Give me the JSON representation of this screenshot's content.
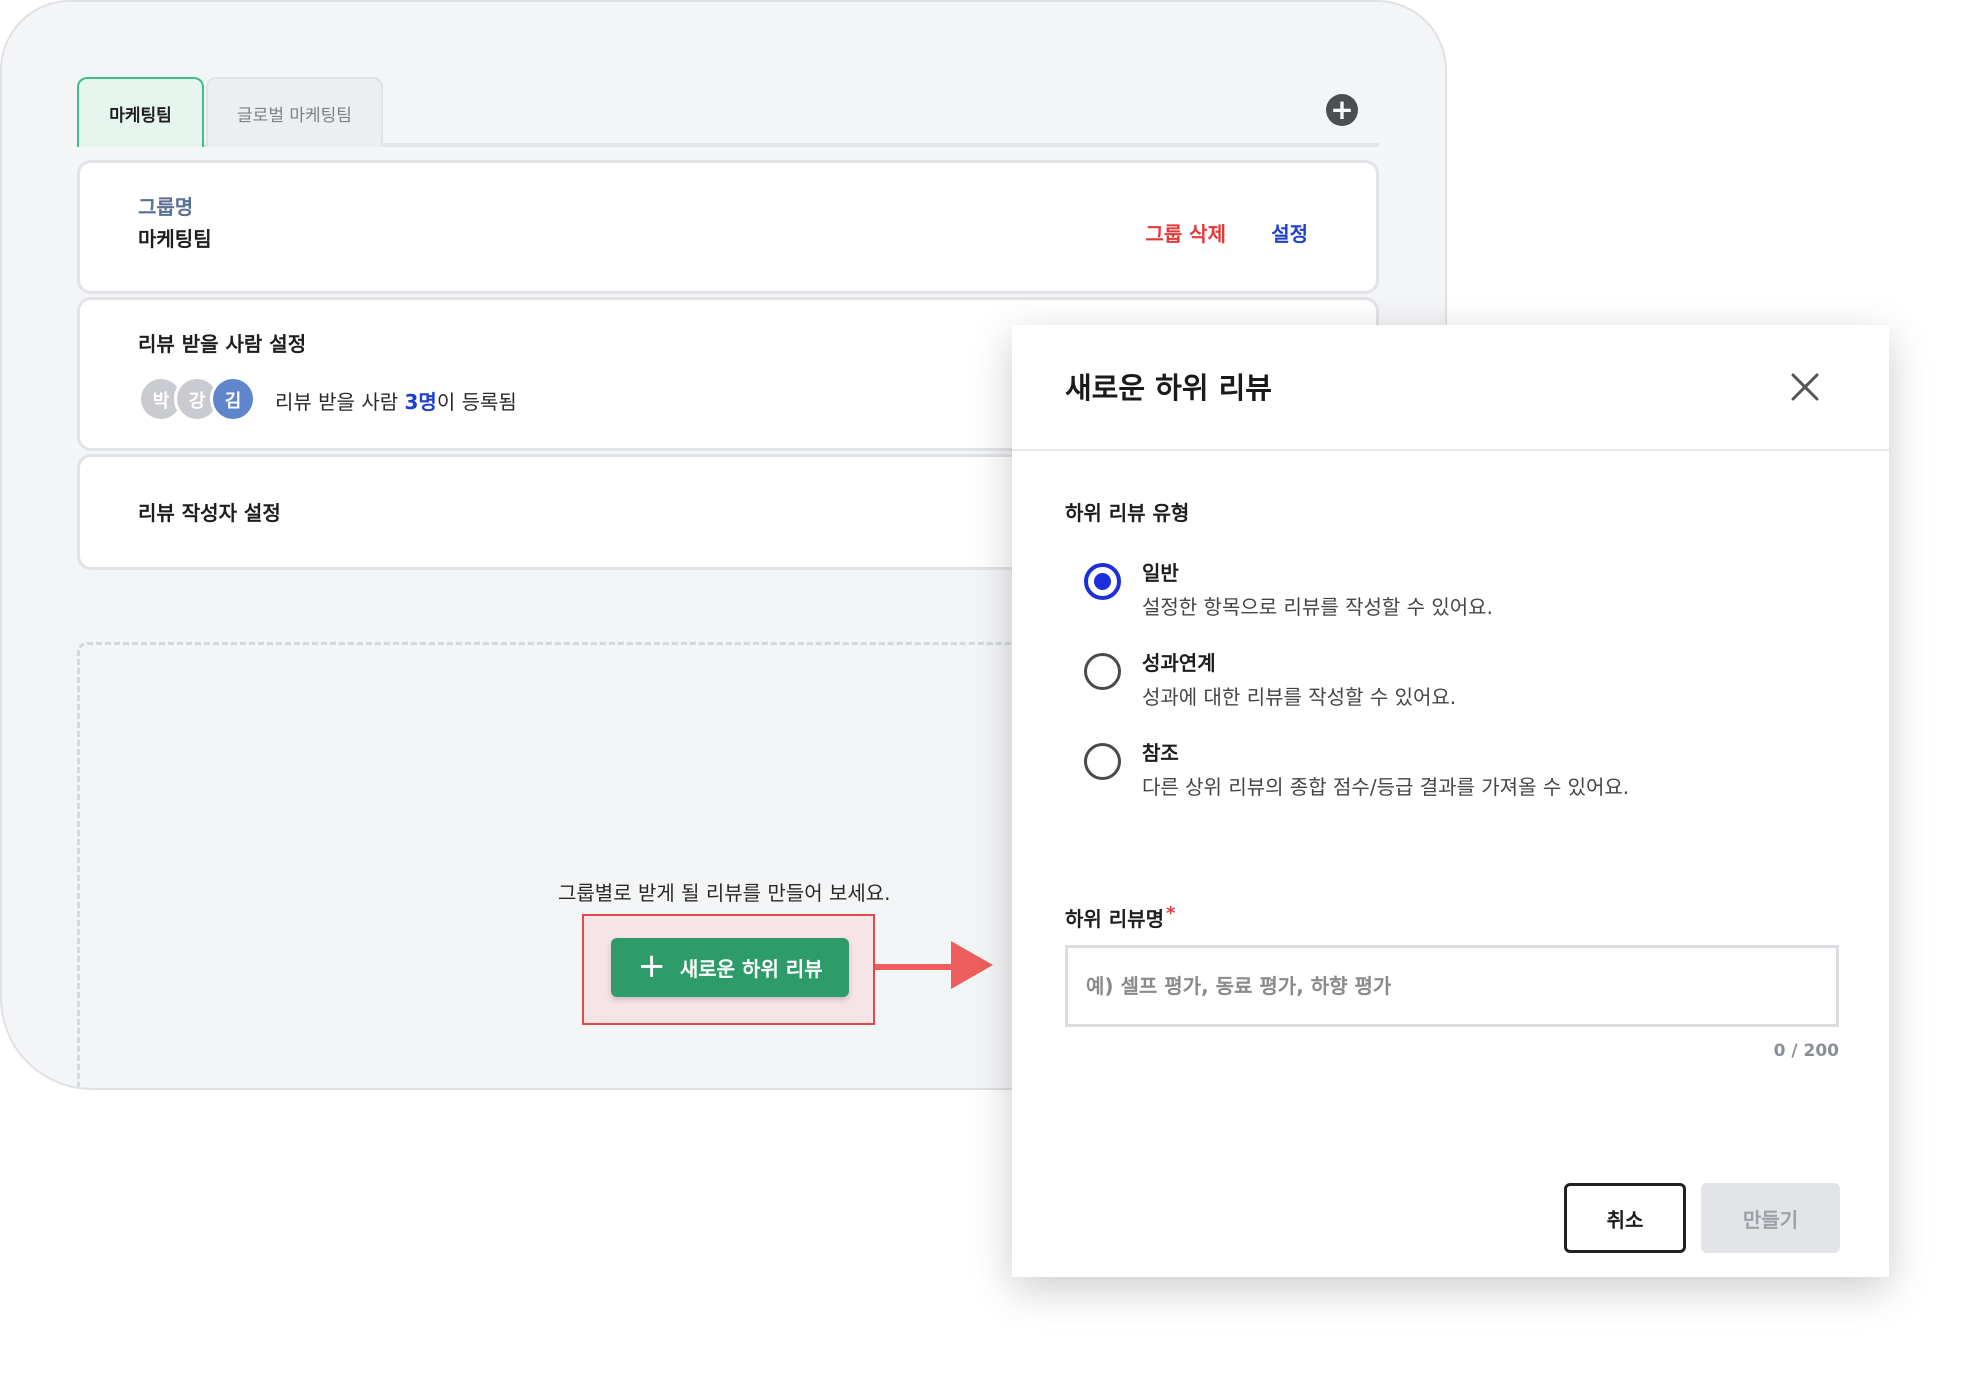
{
  "tabs": {
    "active_label": "마케팅팀",
    "inactive_label": "글로벌 마케팅팀"
  },
  "group_card": {
    "label": "그룹명",
    "name": "마케팅팀",
    "delete_label": "그룹 삭제",
    "settings_label": "설정"
  },
  "reviewee_card": {
    "title": "리뷰 받을 사람 설정",
    "avatars": [
      "박",
      "강",
      "김"
    ],
    "text_prefix": "리뷰 받을 사람 ",
    "count": "3명",
    "text_suffix": "이 등록됨"
  },
  "reviewer_card": {
    "title": "리뷰 작성자 설정"
  },
  "empty_state": {
    "message": "그룹별로 받게 될 리뷰를 만들어 보세요.",
    "button_label": "새로운 하위 리뷰"
  },
  "modal": {
    "title": "새로운 하위 리뷰",
    "type_label": "하위 리뷰 유형",
    "options": [
      {
        "title": "일반",
        "desc": "설정한 항목으로 리뷰를 작성할 수 있어요.",
        "selected": true
      },
      {
        "title": "성과연계",
        "desc": "성과에 대한 리뷰를 작성할 수 있어요.",
        "selected": false
      },
      {
        "title": "참조",
        "desc": "다른 상위 리뷰의 종합 점수/등급 결과를 가져올 수 있어요.",
        "selected": false
      }
    ],
    "name_label": "하위 리뷰명",
    "required_mark": "*",
    "name_value": "",
    "name_placeholder": "예) 셀프 평가, 동료 평가, 하향 평가",
    "char_count": "0 / 200",
    "cancel_label": "취소",
    "create_label": "만들기"
  },
  "colors": {
    "accent_green": "#2e9c6a",
    "radio_blue": "#1d2fdd",
    "danger_red": "#e23a3a",
    "link_blue": "#1d3fcf",
    "arrow_red": "#ee5e5e"
  }
}
